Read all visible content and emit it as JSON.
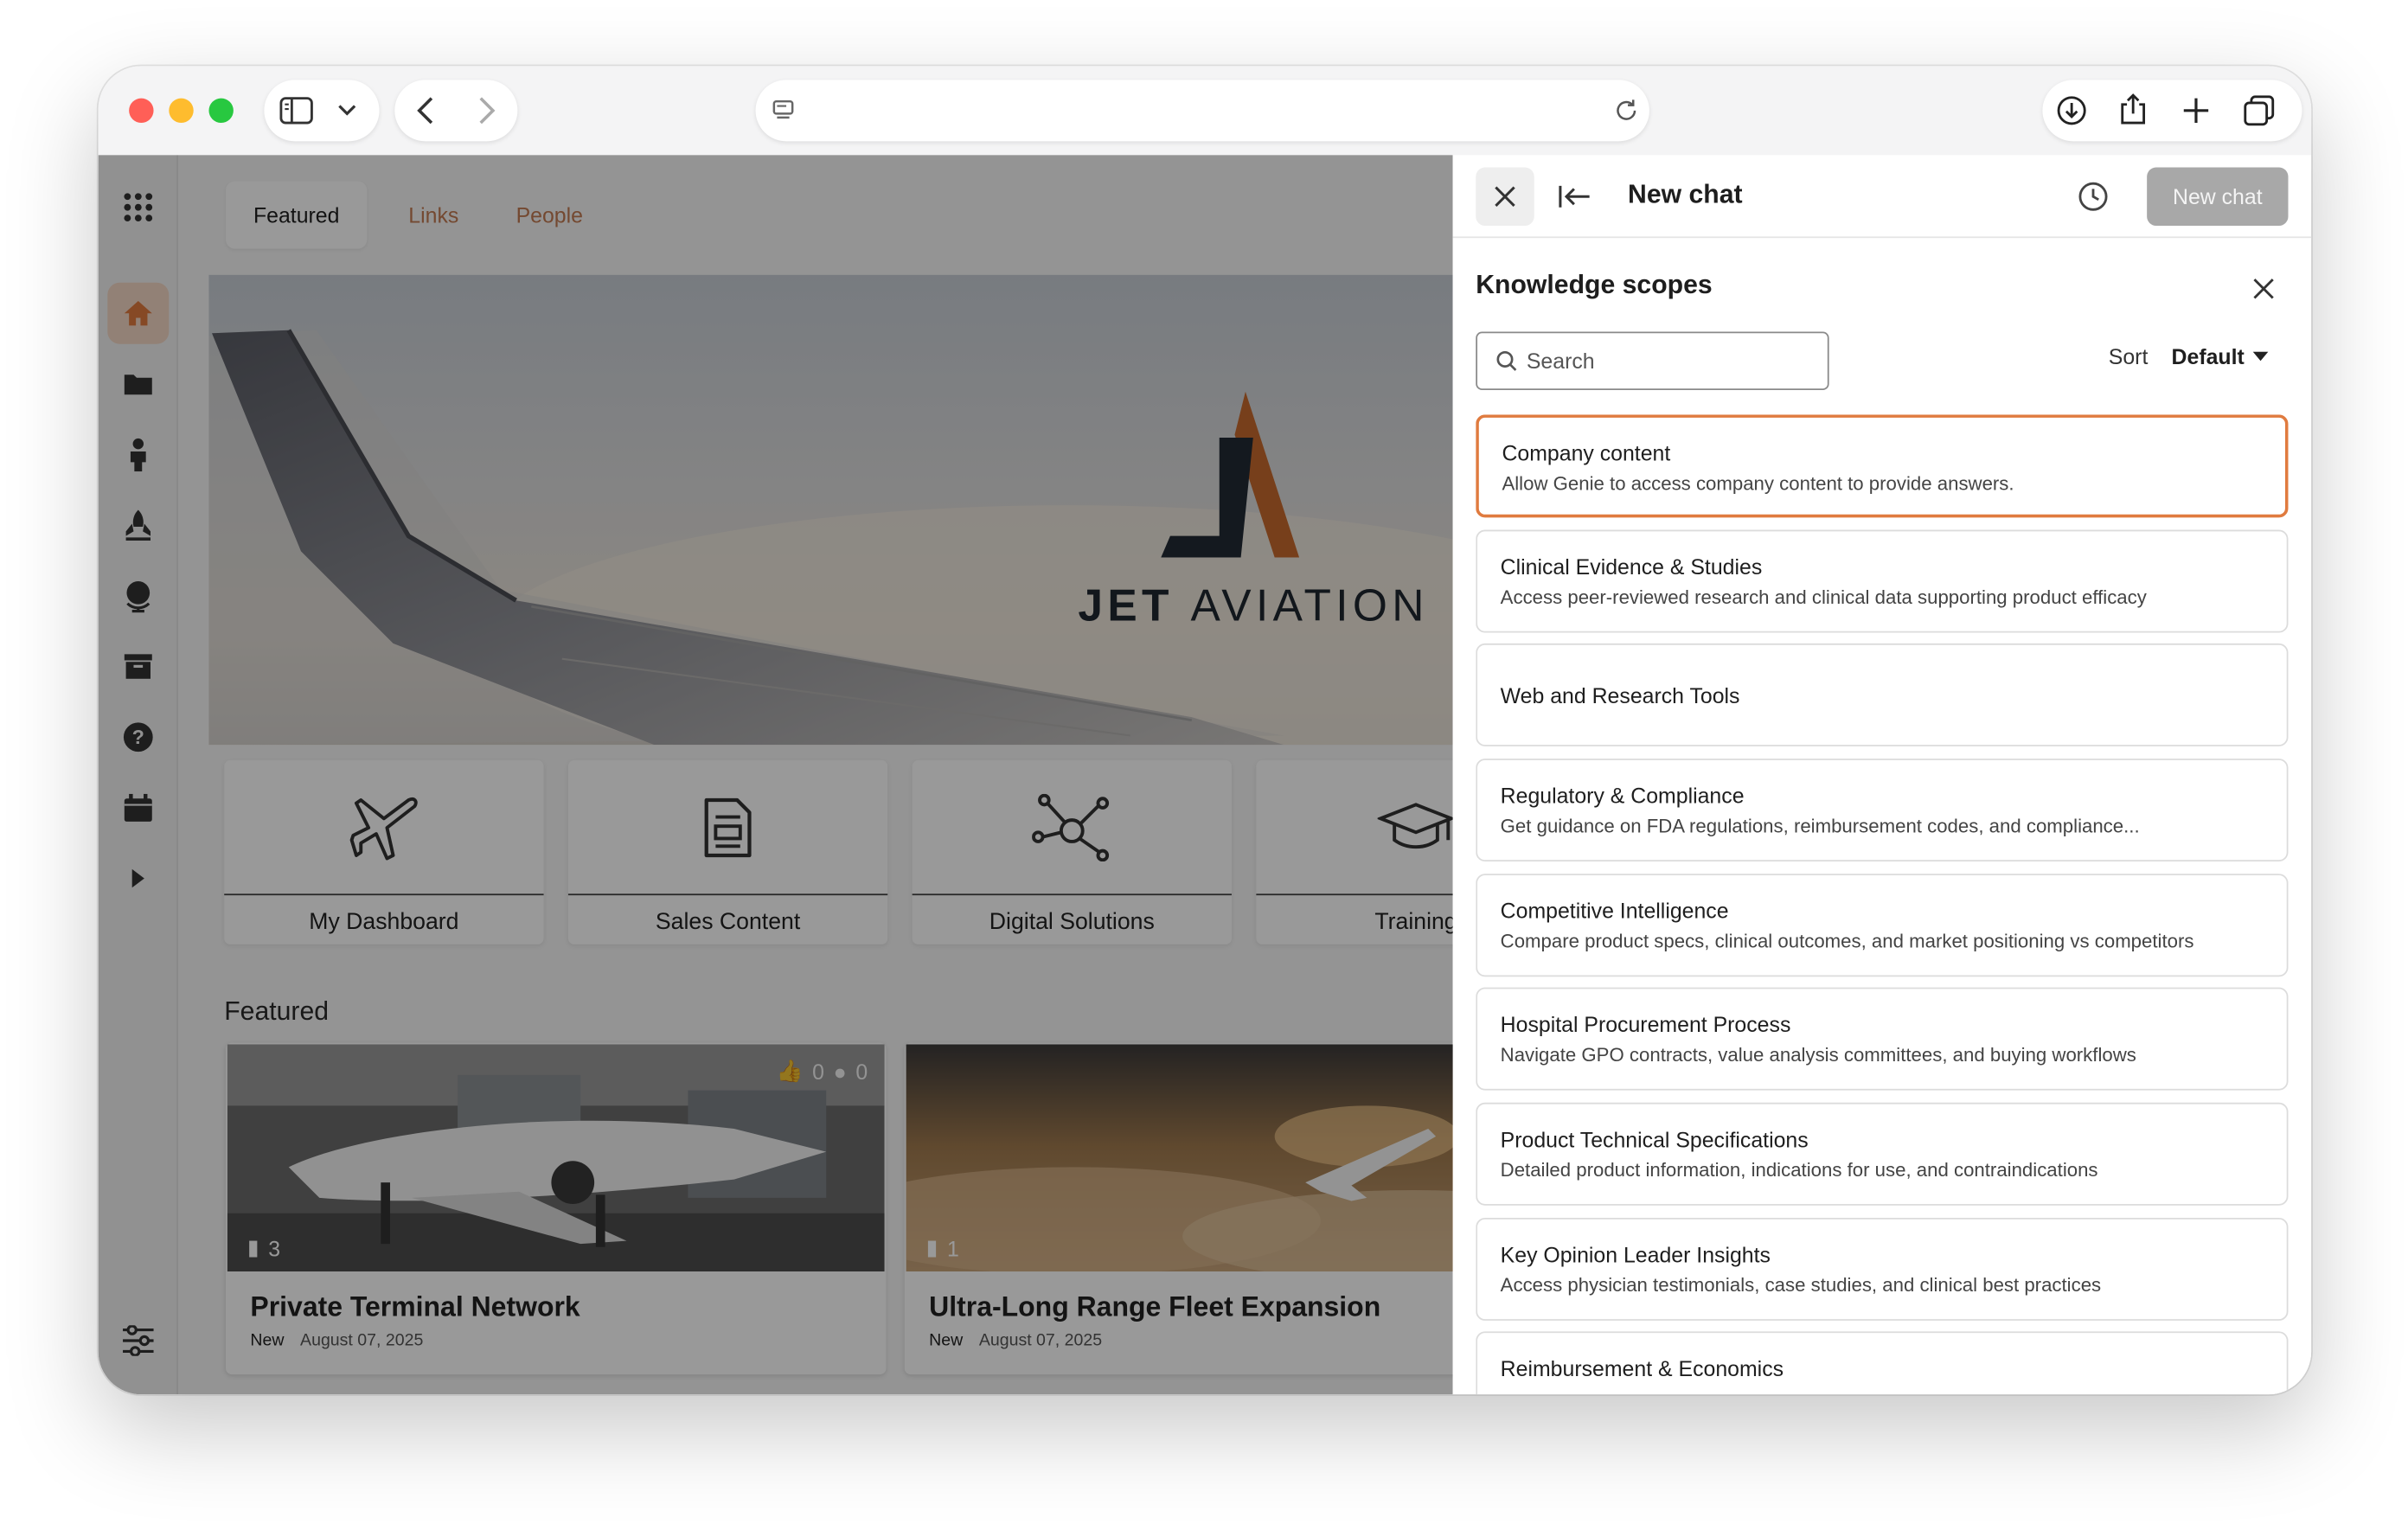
{
  "colors": {
    "accent": "#e07b3f",
    "tab_link": "#c27a52",
    "new_chat_button_bg": "#a8a8a8",
    "traffic_close": "#ff5f57",
    "traffic_minimize": "#febc2e",
    "traffic_zoom": "#28c840"
  },
  "browser": {
    "icons": [
      "sidebar-icon",
      "chevron-down-icon",
      "back-icon",
      "forward-icon",
      "page-icon",
      "reload-icon",
      "download-icon",
      "share-icon",
      "plus-icon",
      "tabs-icon"
    ]
  },
  "rail": {
    "icons": [
      "apps-grid-icon",
      "home-icon",
      "folder-icon",
      "person-icon",
      "rocket-icon",
      "globe-icon",
      "archive-icon",
      "help-icon",
      "calendar-icon",
      "expand-icon",
      "settings-sliders-icon"
    ],
    "active": "home-icon"
  },
  "tabs": [
    {
      "label": "Featured",
      "active": true
    },
    {
      "label": "Links",
      "active": false
    },
    {
      "label": "People",
      "active": false
    }
  ],
  "hero": {
    "logo_text_bold": "JET",
    "logo_text": "AVIATION"
  },
  "tiles": [
    {
      "label": "My Dashboard",
      "icon": "airplane-icon"
    },
    {
      "label": "Sales Content",
      "icon": "document-icon"
    },
    {
      "label": "Digital Solutions",
      "icon": "network-icon"
    },
    {
      "label": "Training",
      "icon": "graduation-cap-icon"
    }
  ],
  "featured": {
    "title": "Featured",
    "cards": [
      {
        "title": "Private Terminal Network",
        "badge": "New",
        "date": "August 07, 2025",
        "count": "3",
        "likes": "0",
        "comments": "0"
      },
      {
        "title": "Ultra-Long Range Fleet Expansion",
        "badge": "New",
        "date": "August 07, 2025",
        "count": "1"
      }
    ]
  },
  "panel": {
    "title": "New chat",
    "new_chat_label": "New chat",
    "header_icons": [
      "close-icon",
      "collapse-left-icon",
      "history-icon"
    ],
    "knowledge": {
      "title": "Knowledge scopes",
      "search_placeholder": "Search",
      "sort_label": "Sort",
      "sort_value": "Default",
      "items": [
        {
          "title": "Company content",
          "desc": "Allow Genie to access company content to provide answers.",
          "selected": true
        },
        {
          "title": "Clinical Evidence & Studies",
          "desc": "Access peer-reviewed research and clinical data supporting product efficacy"
        },
        {
          "title": "Web and Research Tools",
          "desc": ""
        },
        {
          "title": "Regulatory & Compliance",
          "desc": "Get guidance on FDA regulations, reimbursement codes, and compliance..."
        },
        {
          "title": "Competitive Intelligence",
          "desc": "Compare product specs, clinical outcomes, and market positioning vs competitors"
        },
        {
          "title": "Hospital Procurement Process",
          "desc": "Navigate GPO contracts, value analysis committees, and buying workflows"
        },
        {
          "title": "Product Technical Specifications",
          "desc": "Detailed product information, indications for use, and contraindications"
        },
        {
          "title": "Key Opinion Leader Insights",
          "desc": "Access physician testimonials, case studies, and clinical best practices"
        },
        {
          "title": "Reimbursement & Economics",
          "desc": ""
        }
      ]
    }
  }
}
